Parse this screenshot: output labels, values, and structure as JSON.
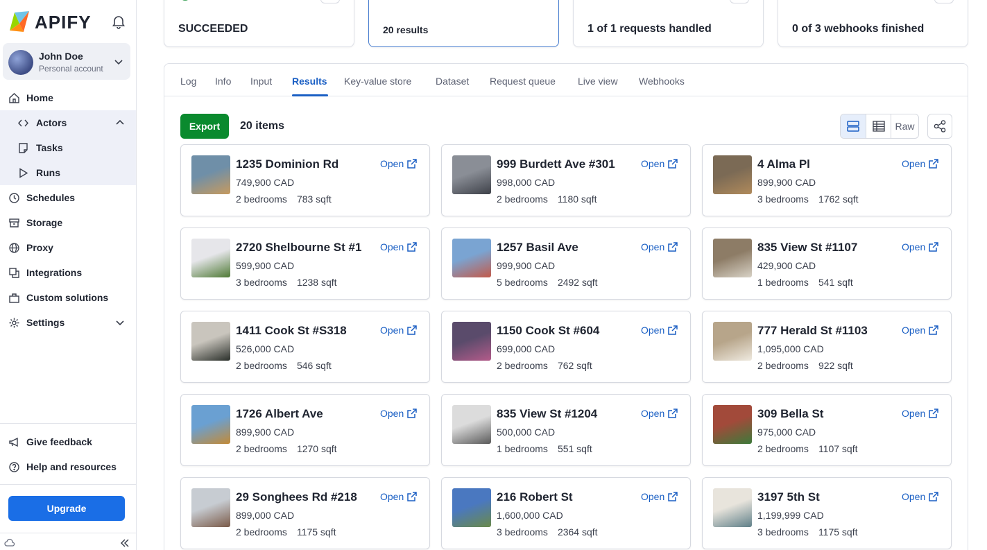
{
  "brand": {
    "name": "APIFY",
    "accent": "#1a6ee6"
  },
  "account": {
    "name": "John Doe",
    "type": "Personal account"
  },
  "nav": {
    "home": "Home",
    "actors": "Actors",
    "tasks": "Tasks",
    "runs": "Runs",
    "schedules": "Schedules",
    "storage": "Storage",
    "proxy": "Proxy",
    "integrations": "Integrations",
    "custom_solutions": "Custom solutions",
    "settings": "Settings",
    "give_feedback": "Give feedback",
    "help": "Help and resources",
    "upgrade": "Upgrade"
  },
  "stats": {
    "status": "SUCCEEDED",
    "results": "20 results",
    "requests": "1 of 1 requests handled",
    "webhooks": "0 of 3 webhooks finished"
  },
  "tabs": [
    "Log",
    "Info",
    "Input",
    "Results",
    "Key-value store",
    "Dataset",
    "Request queue",
    "Live view",
    "Webhooks"
  ],
  "active_tab": "Results",
  "toolbar": {
    "export_label": "Export",
    "items_count": "20 items",
    "raw_label": "Raw"
  },
  "open_label": "Open",
  "listings": [
    {
      "address": "1235 Dominion Rd",
      "price": "749,900 CAD",
      "bedrooms": "2 bedrooms",
      "sqft": "783 sqft"
    },
    {
      "address": "999 Burdett Ave #301",
      "price": "998,000 CAD",
      "bedrooms": "2 bedrooms",
      "sqft": "1180 sqft"
    },
    {
      "address": "4 Alma Pl",
      "price": "899,900 CAD",
      "bedrooms": "3 bedrooms",
      "sqft": "1762 sqft"
    },
    {
      "address": "2720 Shelbourne St #1",
      "price": "599,900 CAD",
      "bedrooms": "3 bedrooms",
      "sqft": "1238 sqft"
    },
    {
      "address": "1257 Basil Ave",
      "price": "999,900 CAD",
      "bedrooms": "5 bedrooms",
      "sqft": "2492 sqft"
    },
    {
      "address": "835 View St #1107",
      "price": "429,900 CAD",
      "bedrooms": "1 bedrooms",
      "sqft": "541 sqft"
    },
    {
      "address": "1411 Cook St #S318",
      "price": "526,000 CAD",
      "bedrooms": "2 bedrooms",
      "sqft": "546 sqft"
    },
    {
      "address": "1150 Cook St #604",
      "price": "699,000 CAD",
      "bedrooms": "2 bedrooms",
      "sqft": "762 sqft"
    },
    {
      "address": "777 Herald St #1103",
      "price": "1,095,000 CAD",
      "bedrooms": "2 bedrooms",
      "sqft": "922 sqft"
    },
    {
      "address": "1726 Albert Ave",
      "price": "899,900 CAD",
      "bedrooms": "2 bedrooms",
      "sqft": "1270 sqft"
    },
    {
      "address": "835 View St #1204",
      "price": "500,000 CAD",
      "bedrooms": "1 bedrooms",
      "sqft": "551 sqft"
    },
    {
      "address": "309 Bella St",
      "price": "975,000 CAD",
      "bedrooms": "2 bedrooms",
      "sqft": "1107 sqft"
    },
    {
      "address": "29 Songhees Rd #218",
      "price": "899,000 CAD",
      "bedrooms": "2 bedrooms",
      "sqft": "1175 sqft"
    },
    {
      "address": "216 Robert St",
      "price": "1,600,000 CAD",
      "bedrooms": "3 bedrooms",
      "sqft": "2364 sqft"
    },
    {
      "address": "3197 5th St",
      "price": "1,199,999 CAD",
      "bedrooms": "3 bedrooms",
      "sqft": "1175 sqft"
    }
  ]
}
